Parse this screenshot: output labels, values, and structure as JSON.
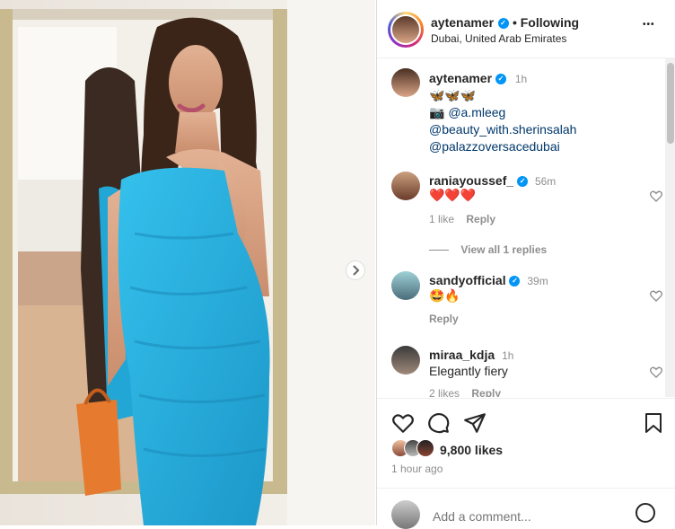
{
  "post": {
    "username": "aytenamer",
    "follow_label": "Following",
    "location": "Dubai, United Arab Emirates",
    "more_label": "•••"
  },
  "caption": {
    "username": "aytenamer",
    "time": "1h",
    "line1": "🦋🦋🦋",
    "camera": "📷",
    "mention1": "@a.mleeg",
    "mention2": "@beauty_with.sherinsalah",
    "mention3": "@palazzoversacedubai"
  },
  "comments": [
    {
      "username": "raniayoussef_",
      "time": "56m",
      "text": "❤️❤️❤️",
      "likes": "1 like",
      "reply": "Reply",
      "view_replies": "View all 1 replies"
    },
    {
      "username": "sandyofficial",
      "time": "39m",
      "text": "🤩🔥",
      "reply": "Reply"
    },
    {
      "username": "miraa_kdja",
      "time": "1h",
      "text": "Elegantly fiery",
      "likes": "2 likes",
      "reply": "Reply"
    }
  ],
  "footer": {
    "likes": "9,800 likes",
    "time": "1 hour ago",
    "add_comment_placeholder": "Add a comment...",
    "emoji": "☺"
  },
  "colors": {
    "dress": "#2fb3e0",
    "verified": "#0095f6",
    "link": "#00376b"
  }
}
